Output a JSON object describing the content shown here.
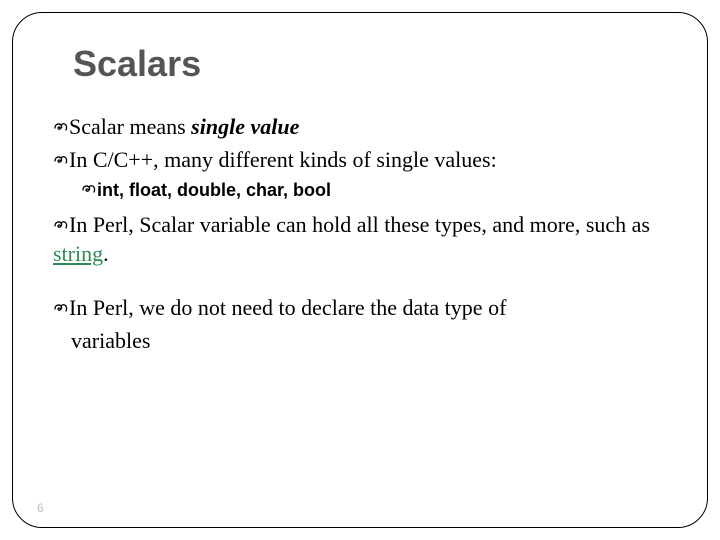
{
  "slide": {
    "title": "Scalars",
    "bullets": {
      "b1_prefix": "Scalar means ",
      "b1_em": "single value",
      "b2": "In C/C++, many different kinds of single values:",
      "b2_sub": "int, float, double, char, bool",
      "b3_prefix": "In Perl, Scalar variable can hold all these types, and more, such as ",
      "b3_link": "string",
      "b3_suffix": ".",
      "b4_line1": "In Perl, we do not need to declare the data type of",
      "b4_line2": "variables"
    },
    "glyph": "་",
    "page_number": "6"
  }
}
